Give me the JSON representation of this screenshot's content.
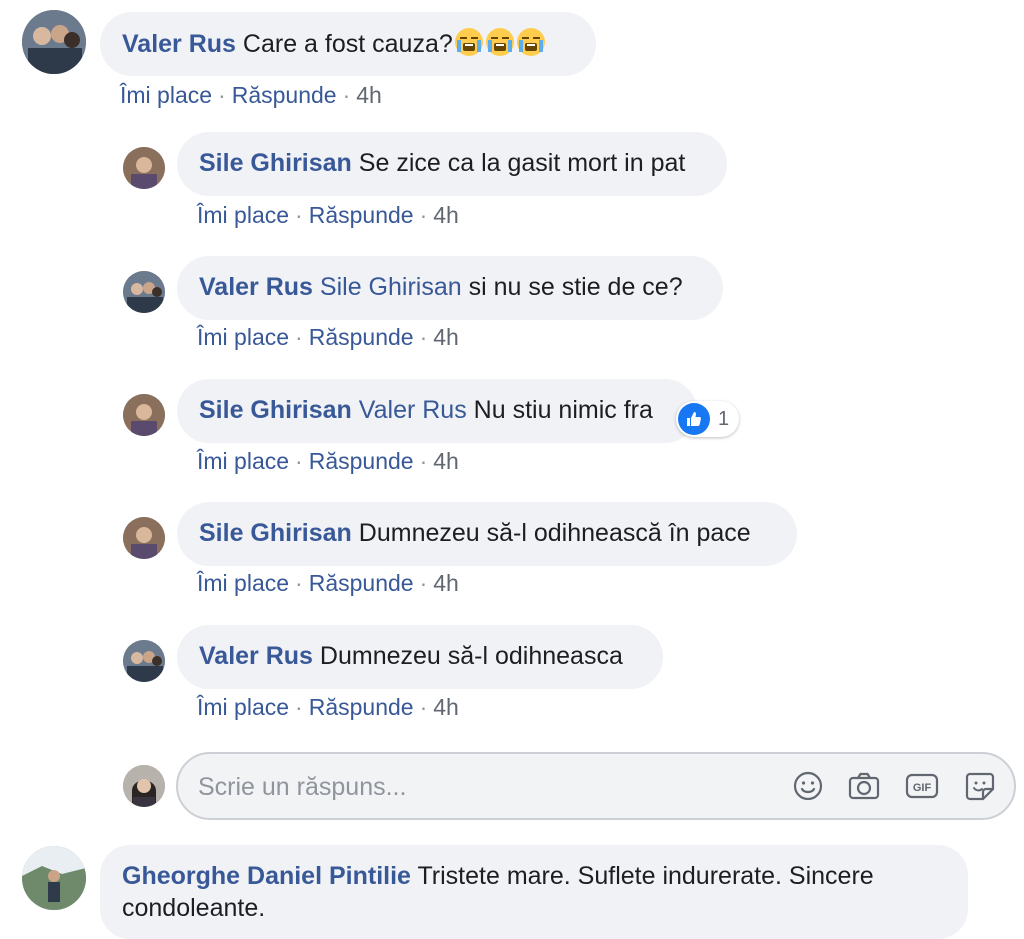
{
  "action_labels": {
    "like": "Îmi place",
    "reply": "Răspunde",
    "separator": "·"
  },
  "comments": [
    {
      "author": "Valer Rus",
      "mention": "",
      "text": "Care a fost cauza?",
      "emoji": "crying-face x3",
      "time": "4h"
    },
    {
      "author": "Sile Ghirisan",
      "mention": "",
      "text": "Se zice ca la gasit mort in pat",
      "time": "4h"
    },
    {
      "author": "Valer Rus",
      "mention": "Sile Ghirisan",
      "text": "si nu se stie de ce?",
      "time": "4h"
    },
    {
      "author": "Sile Ghirisan",
      "mention": "Valer Rus",
      "text": "Nu stiu nimic fra",
      "time": "4h",
      "reaction_count": "1"
    },
    {
      "author": "Sile Ghirisan",
      "mention": "",
      "text": "Dumnezeu să-l odihnească în pace",
      "time": "4h"
    },
    {
      "author": "Valer Rus",
      "mention": "",
      "text": "Dumnezeu să-l odihneasca",
      "time": "4h"
    },
    {
      "author": "Gheorghe Daniel Pintilie",
      "mention": "",
      "text": "Tristete mare. Suflete indurerate. Sincere condoleante."
    }
  ],
  "reply_box": {
    "placeholder": "Scrie un răspuns...",
    "tools": [
      "smiley-icon",
      "camera-icon",
      "gif-icon",
      "sticker-icon"
    ]
  },
  "colors": {
    "name": "#385898",
    "bubble": "#f0f2f5",
    "like": "#1877f2"
  }
}
